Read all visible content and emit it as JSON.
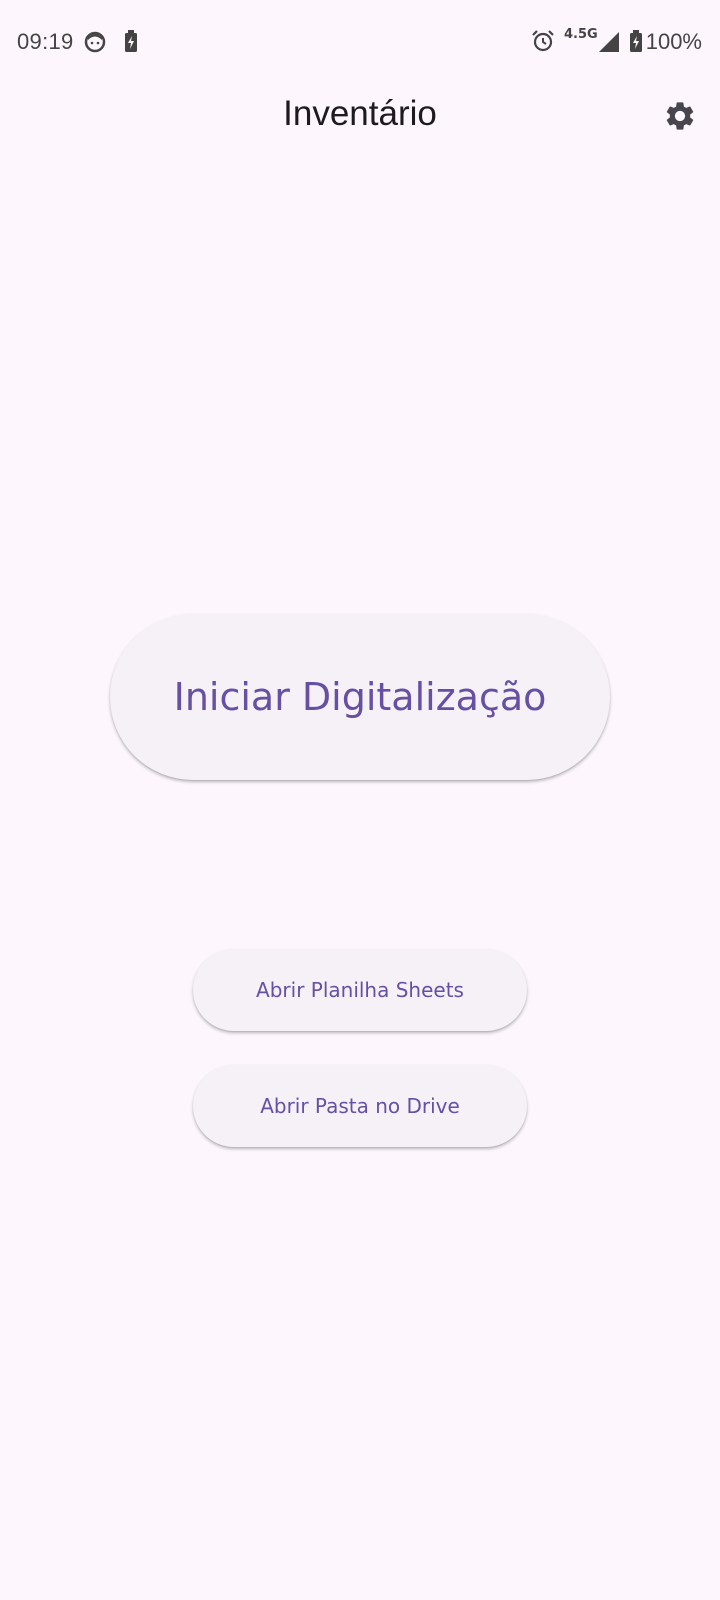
{
  "status_bar": {
    "time": "09:19",
    "network": "4.5G",
    "battery": "100%",
    "icons": [
      "face-icon",
      "battery-saver-icon",
      "alarm-icon",
      "signal-icon",
      "battery-charging-icon"
    ]
  },
  "app_bar": {
    "title": "Inventário",
    "settings_icon": "gear-icon"
  },
  "main": {
    "primary_button": "Iniciar Digitalização",
    "sheets_button": "Abrir Planilha Sheets",
    "drive_button": "Abrir Pasta no Drive"
  },
  "colors": {
    "background": "#fdf7fd",
    "button_surface": "#f5f1f7",
    "accent": "#6750a4",
    "text": "#1d1b20"
  }
}
